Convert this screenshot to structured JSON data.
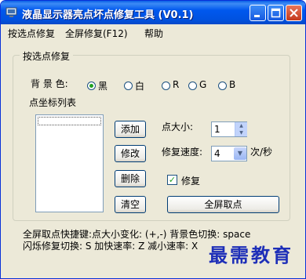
{
  "window": {
    "title": "液晶显示器亮点坏点修复工具 (V0.1)"
  },
  "menu": {
    "items": [
      "按选点修复",
      "全屏修复(F12)",
      "帮助"
    ]
  },
  "group": {
    "title": "按选点修复"
  },
  "background_color": {
    "label": "背 景 色:",
    "options": [
      {
        "label": "黑",
        "selected": true
      },
      {
        "label": "白",
        "selected": false
      },
      {
        "label": "R",
        "selected": false
      },
      {
        "label": "G",
        "selected": false
      },
      {
        "label": "B",
        "selected": false
      }
    ]
  },
  "coord_list": {
    "label": "点坐标列表",
    "items": []
  },
  "buttons": {
    "add": "添加",
    "edit": "修改",
    "delete": "删除",
    "clear": "清空",
    "fullscreen": "全屏取点"
  },
  "point_size": {
    "label": "点大小:",
    "value": "1"
  },
  "repair_speed": {
    "label": "修复速度:",
    "value": "4",
    "unit": "次/秒"
  },
  "repair_checkbox": {
    "label": "修复",
    "checked": true
  },
  "help_text": {
    "line1": "全屏取点快捷键:点大小变化: (+,-)   背景色切换: space",
    "line2": "闪烁修复切换: S  加快速率: Z  减小速率: X"
  },
  "watermark": {
    "text": "最需教育"
  },
  "colors": {
    "title_bar": "#0054e3",
    "window_bg": "#ece9d8",
    "watermark": "#1e2fb8"
  }
}
